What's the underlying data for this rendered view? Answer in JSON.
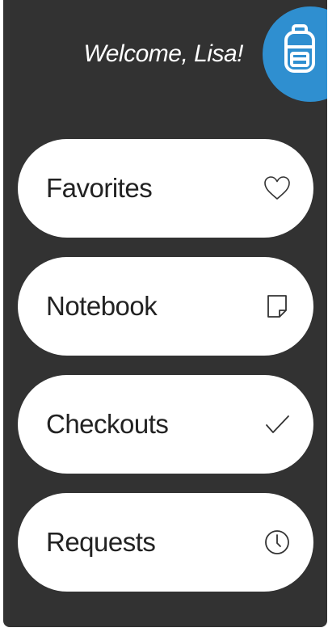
{
  "header": {
    "welcome_text": "Welcome, Lisa!",
    "avatar_icon": "backpack-icon",
    "avatar_color": "#2f8fd0"
  },
  "menu": {
    "items": [
      {
        "label": "Favorites",
        "icon": "heart-icon"
      },
      {
        "label": "Notebook",
        "icon": "note-icon"
      },
      {
        "label": "Checkouts",
        "icon": "checkmark-icon"
      },
      {
        "label": "Requests",
        "icon": "clock-icon"
      }
    ]
  },
  "colors": {
    "panel_background": "#323232",
    "item_background": "#ffffff",
    "text_dark": "#222222"
  }
}
